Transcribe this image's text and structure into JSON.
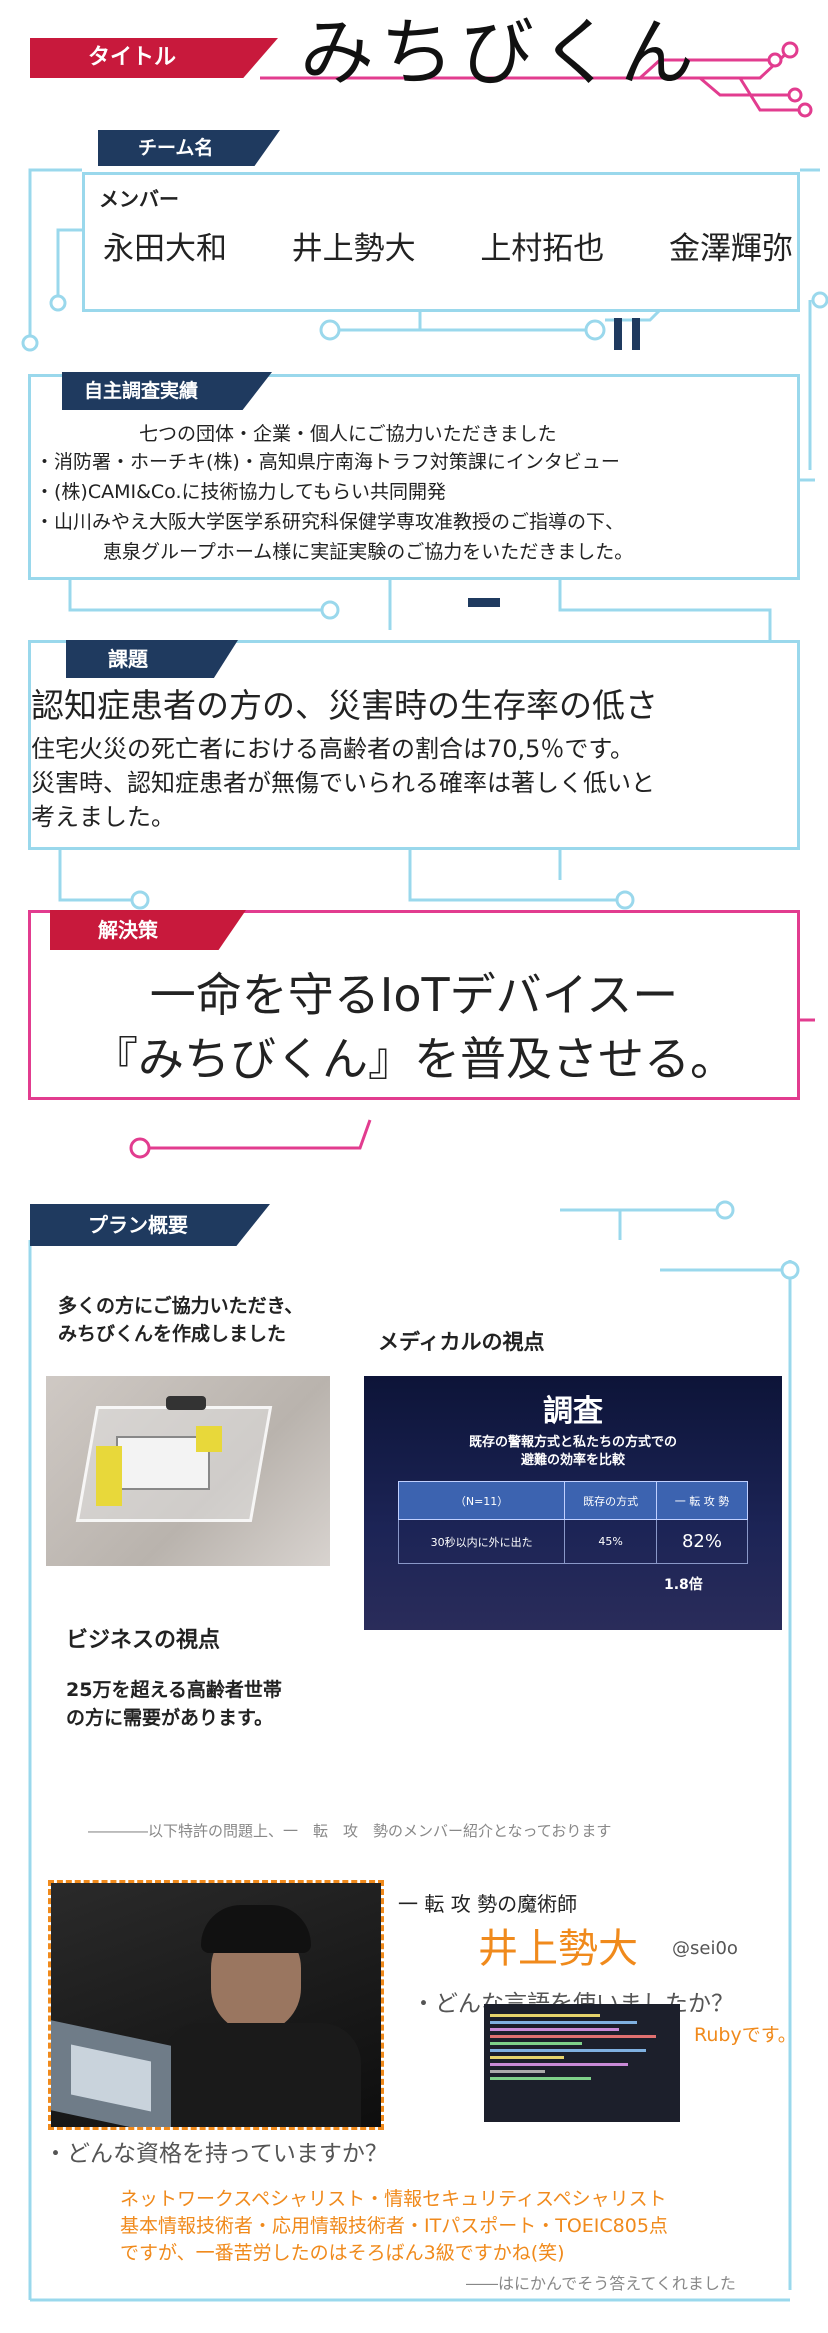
{
  "header": {
    "title_tag": "タイトル",
    "title": "みちびくん"
  },
  "team": {
    "tag": "チーム名",
    "members_label": "メンバー",
    "members": [
      "永田大和",
      "井上勢大",
      "上村拓也",
      "金澤輝弥"
    ]
  },
  "research": {
    "tag": "自主調査実績",
    "lines": [
      "七つの団体・企業・個人にご協力いただきました",
      "・消防署・ホーチキ(株)・高知県庁南海トラフ対策課にインタビュー",
      "・(株)CAMI&Co.に技術協力してもらい共同開発",
      "・山川みやえ大阪大学医学系研究科保健学専攻准教授のご指導の下、",
      "恵泉グループホーム様に実証実験のご協力をいただきました。"
    ]
  },
  "problem": {
    "tag": "課題",
    "headline": "認知症患者の方の、災害時の生存率の低さ",
    "lines": [
      "住宅火災の死亡者における高齢者の割合は70,5％です。",
      "災害時、認知症患者が無傷でいられる確率は著しく低いと",
      "考えました。"
    ]
  },
  "solution": {
    "tag": "解決策",
    "lines": [
      "一命を守るIoTデバイスー",
      "『みちびくん』を普及させる。"
    ]
  },
  "plan": {
    "tag": "プラン概要",
    "coop_lines": [
      "多くの方にご協力いただき、",
      "みちびくんを作成しました"
    ],
    "medical_heading": "メディカルの視点",
    "slide": {
      "title": "調査",
      "subtitle_lines": [
        "既存の警報方式と私たちの方式での",
        "避難の効率を比較"
      ],
      "headers": [
        "（N=11）",
        "既存の方式",
        "一 転 攻 勢"
      ],
      "row": [
        "30秒以内に外に出た",
        "45%",
        "82%"
      ],
      "ratio": "1.8倍"
    },
    "business_heading": "ビジネスの視点",
    "business_lines": [
      "25万を超える高齢者世帯",
      "の方に需要があります。"
    ],
    "note": "――――以下特許の問題上、一　転　攻　勢のメンバー紹介となっております",
    "profile": {
      "role": "一 転 攻 勢の魔術師",
      "name": "井上勢大",
      "handle": "@sei0o",
      "q1": "・どんな言語を使いましたか？",
      "a1": "Rubyです。",
      "q2": "・どんな資格を持っていますか？",
      "a2_lines": [
        "ネットワークスペシャリスト・情報セキュリティスペシャリスト",
        "基本情報技術者・応用情報技術者・ITパスポート・TOEIC805点",
        "ですが、一番苦労したのはそろばん3級ですかね(笑)"
      ],
      "footer": "――はにかんでそう答えてくれました"
    }
  },
  "colors": {
    "navy": "#1f3a5f",
    "crimson": "#c8193c",
    "cyan": "#9ad8ec",
    "pink": "#e23c8f",
    "orange": "#f08a1c"
  }
}
